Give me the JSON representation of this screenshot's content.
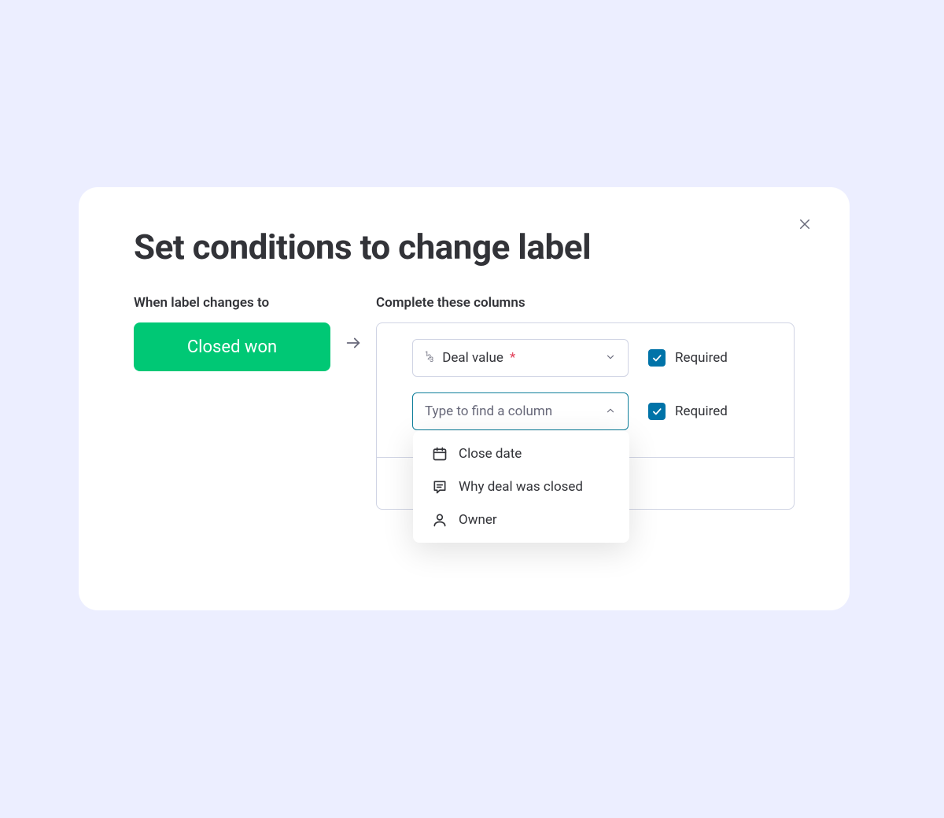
{
  "modal": {
    "title": "Set conditions to change label"
  },
  "trigger": {
    "label": "When label changes to",
    "status": "Closed won"
  },
  "columns": {
    "label": "Complete these columns",
    "selected": {
      "name": "Deal value",
      "required_label": "Required"
    },
    "search": {
      "placeholder": "Type to find a column",
      "required_label": "Required"
    },
    "options": [
      {
        "icon": "calendar",
        "label": "Close date"
      },
      {
        "icon": "chat",
        "label": "Why deal was closed"
      },
      {
        "icon": "person",
        "label": "Owner"
      }
    ]
  }
}
